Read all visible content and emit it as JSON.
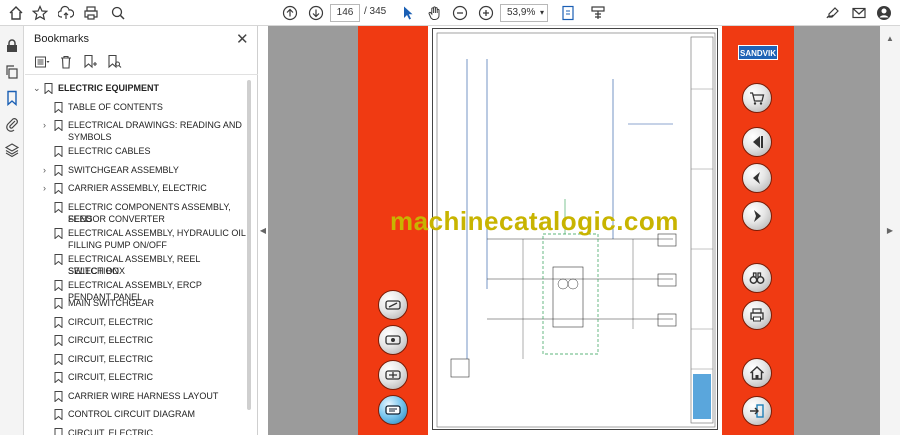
{
  "toolbar": {
    "page_current": "146",
    "page_total": "/ 345",
    "zoom": "53,9%",
    "icons": [
      "home-icon",
      "star-icon",
      "upload-icon",
      "print-icon",
      "zoom-search-icon",
      "page-up-icon",
      "page-down-icon",
      "pointer-icon",
      "hand-icon",
      "zoom-out-icon",
      "zoom-in-icon",
      "fit-page-icon",
      "scroll-mode-icon",
      "sign-icon",
      "email-icon",
      "account-icon"
    ]
  },
  "rail": {
    "icons": [
      "lock-icon",
      "copy-icon",
      "bookmark-icon",
      "paperclip-icon",
      "layers-icon"
    ]
  },
  "bookmarks": {
    "title": "Bookmarks",
    "items": [
      {
        "label": "ELECTRIC EQUIPMENT",
        "level": 0,
        "expanded": true
      },
      {
        "label": "TABLE OF CONTENTS",
        "level": 1,
        "expanded": null
      },
      {
        "label": "ELECTRICAL DRAWINGS: READING AND",
        "label2": "SYMBOLS",
        "level": 1,
        "expanded": false
      },
      {
        "label": "ELECTRIC CABLES",
        "level": 1,
        "expanded": null
      },
      {
        "label": "SWITCHGEAR ASSEMBLY",
        "level": 1,
        "expanded": false
      },
      {
        "label": "CARRIER ASSEMBLY, ELECTRIC",
        "level": 1,
        "expanded": false
      },
      {
        "label": "ELECTRIC COMPONENTS ASSEMBLY, FEED",
        "label2": "SENSOR CONVERTER",
        "level": 1,
        "expanded": null
      },
      {
        "label": "ELECTRICAL ASSEMBLY, HYDRAULIC OIL",
        "label2": "FILLING PUMP ON/OFF",
        "level": 1,
        "expanded": null
      },
      {
        "label": "ELECTRICAL ASSEMBLY, REEL SELECTION",
        "label2": "SWITCH BOX",
        "level": 1,
        "expanded": null
      },
      {
        "label": "ELECTRICAL ASSEMBLY, ERCP PENDANT PANEL",
        "level": 1,
        "expanded": null
      },
      {
        "label": "MAIN SWITCHGEAR",
        "level": 1,
        "expanded": null
      },
      {
        "label": "CIRCUIT, ELECTRIC",
        "level": 1,
        "expanded": null
      },
      {
        "label": "CIRCUIT, ELECTRIC",
        "level": 1,
        "expanded": null
      },
      {
        "label": "CIRCUIT, ELECTRIC",
        "level": 1,
        "expanded": null
      },
      {
        "label": "CIRCUIT, ELECTRIC",
        "level": 1,
        "expanded": null
      },
      {
        "label": "CARRIER WIRE HARNESS LAYOUT",
        "level": 1,
        "expanded": null
      },
      {
        "label": "CONTROL CIRCUIT DIAGRAM",
        "level": 1,
        "expanded": null
      },
      {
        "label": "CIRCUIT, ELECTRIC",
        "level": 1,
        "expanded": null
      }
    ]
  },
  "document": {
    "brand": "SANDVIK",
    "watermark": "machinecatalogic.com",
    "left_buttons": [
      "wrench-icon",
      "gauge-icon",
      "tools-icon",
      "manual-icon"
    ],
    "right_buttons": [
      "cart-icon",
      "first-page-icon",
      "previous-icon",
      "next-icon",
      "binoculars-icon",
      "print-icon",
      "home-icon",
      "exit-icon"
    ]
  },
  "colors": {
    "accent_orange": "#f03a12",
    "doc_gray": "#9b9b9b",
    "sandvik_blue": "#1f63b6",
    "watermark": "#c8b400"
  }
}
